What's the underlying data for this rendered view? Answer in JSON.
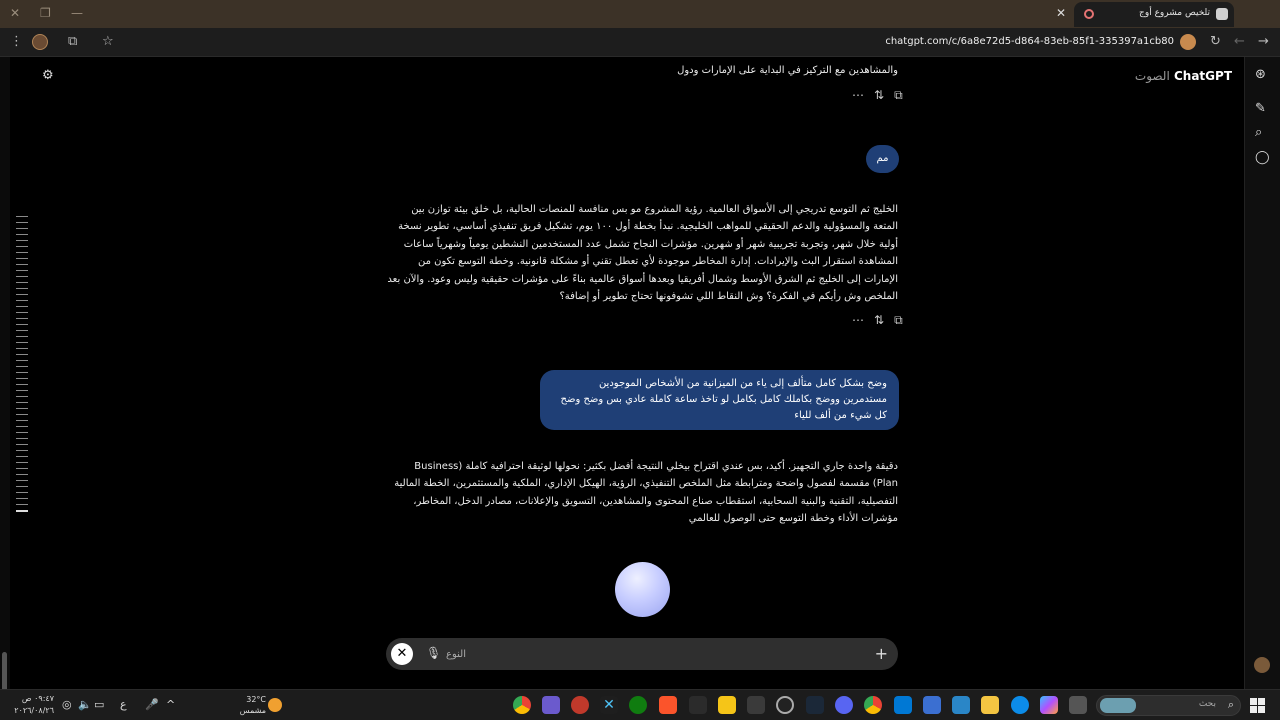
{
  "browser": {
    "tab_title": "تلخيص مشروع أوج",
    "url": "chatgpt.com/c/6a8e72d5-d864-83eb-85f1-335397a1cb80",
    "icons": [
      "close-icon",
      "new-tab-icon",
      "reload-icon",
      "back-icon",
      "forward-icon",
      "star-icon",
      "extensions-icon",
      "menu-icon"
    ]
  },
  "app": {
    "brand": "ChatGPT",
    "brand_sub": "الصوت"
  },
  "messages": {
    "m1_text": "والمشاهدين مع التركيز في البداية على الإمارات ودول",
    "u1_text": "مم",
    "m2_text": "الخليج ثم التوسع تدريجي إلى الأسواق العالمية. رؤية المشروع مو بس منافسة للمنصات الحالية، بل خلق بيئة توازن بين المتعة والمسؤولية والدعم الحقيقي للمواهب الخليجية. نبدأ بخطة أول ١٠٠ يوم، تشكيل فريق تنفيذي أساسي، تطوير نسخة أولية خلال شهر، وتجربة تجريبية شهر أو شهرين. مؤشرات النجاح تشمل عدد المستخدمين النشطين يومياً وشهرياً ساعات المشاهدة استقرار البث والإيرادات. إدارة المخاطر موجودة لأي تعطل تقني أو مشكلة قانونية. وخطة التوسع تكون من الإمارات إلى الخليج ثم الشرق الأوسط وشمال أفريقيا وبعدها أسواق عالمية بناءً على مؤشرات حقيقية وليس وعود. والآن بعد الملخص وش رأيكم في الفكرة؟ وش النقاط اللي تشوفونها تحتاج تطوير أو إضافة؟",
    "u2_text": "وضح بشكل كامل متألف إلى ياء من الميزانية من الأشخاص الموجودين مستدمرين ووضح بكاملك كامل بكامل لو تاخذ ساعة كاملة عادي بس وضح وضح كل شيء من ألف للياء",
    "m3_text": "دقيقة واحدة جاري التجهيز. أكيد، بس عندي اقتراح بيخلي النتيجة أفضل بكثير: نحولها لوثيقة احترافية كاملة (Business Plan) مقسمة لفصول واضحة ومترابطة مثل الملخص التنفيذي، الرؤية، الهيكل الإداري، الملكية والمستثمرين، الخطة المالية التفصيلية، التقنية والبنية السحابية، استقطاب صناع المحتوى والمشاهدين، التسويق والإعلانات، مصادر الدخل، المخاطر، مؤشرات الأداء وخطة التوسع حتى الوصول للعالمي"
  },
  "composer": {
    "placeholder": "النوع"
  },
  "taskbar": {
    "time": "٠٩:٤٧ ص",
    "date": "٢٠٢٦/٠٨/٢٦",
    "lang": "ع",
    "temp": "32°C",
    "weather": "مشمس",
    "search_placeholder": "بحث"
  },
  "colors": {
    "user_bubble": "#1f3f76",
    "composer_bg": "#2f2f2f",
    "orb": "#c6ccff"
  }
}
